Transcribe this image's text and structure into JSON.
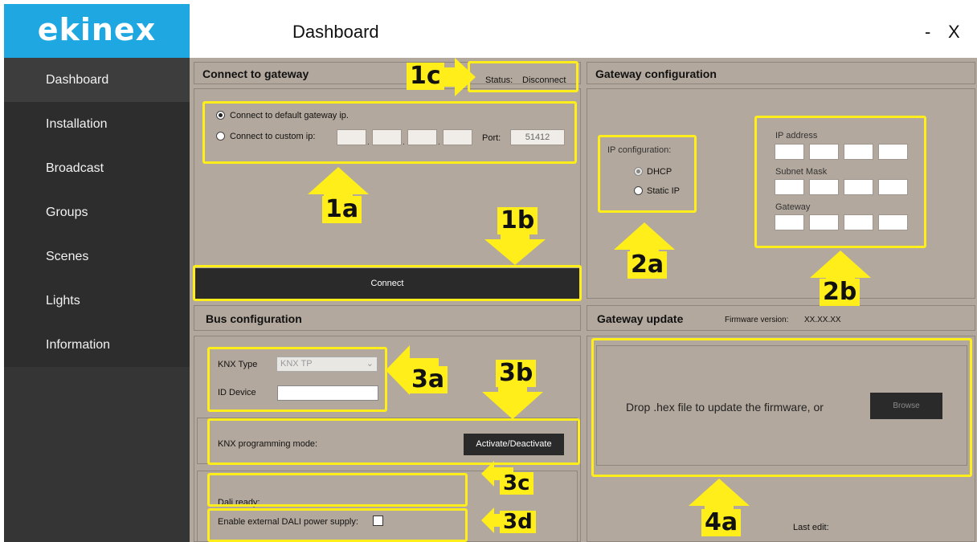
{
  "app": {
    "logo_text": "ekinex",
    "title": "Dashboard",
    "minimize_label": "-",
    "close_label": "X"
  },
  "sidebar": {
    "items": [
      {
        "label": "Dashboard",
        "active": true
      },
      {
        "label": "Installation",
        "active": false
      },
      {
        "label": "Broadcast",
        "active": false
      },
      {
        "label": "Groups",
        "active": false
      },
      {
        "label": "Scenes",
        "active": false
      },
      {
        "label": "Lights",
        "active": false
      },
      {
        "label": "Information",
        "active": false
      }
    ]
  },
  "connect": {
    "title": "Connect to gateway",
    "status_label": "Status:",
    "status_value": "Disconnect",
    "option_default": "Connect to default gateway ip.",
    "option_custom": "Connect to custom ip:",
    "port_label": "Port:",
    "port_value": "51412",
    "connect_button": "Connect"
  },
  "gateway_config": {
    "title": "Gateway configuration",
    "ip_config_label": "IP configuration:",
    "dhcp_label": "DHCP",
    "static_label": "Static IP",
    "ip_address_label": "IP address",
    "subnet_label": "Subnet Mask",
    "gateway_label": "Gateway"
  },
  "bus": {
    "title": "Bus configuration",
    "knx_type_label": "KNX Type",
    "knx_type_value": "KNX TP",
    "id_device_label": "ID Device",
    "id_device_value": "",
    "prog_mode_label": "KNX programming mode:",
    "activate_button": "Activate/Deactivate",
    "dali_ready_label": "Dali ready:",
    "dali_power_label": "Enable external DALI power supply:"
  },
  "update": {
    "title": "Gateway update",
    "firmware_label": "Firmware version:",
    "firmware_value": "XX.XX.XX",
    "drop_text": "Drop .hex file to update the firmware, or",
    "browse_button": "Browse",
    "last_edit_label": "Last edit:"
  },
  "callouts": [
    "1a",
    "1b",
    "1c",
    "2a",
    "2b",
    "3a",
    "3b",
    "3c",
    "3d",
    "4a"
  ],
  "colors": {
    "brand_blue": "#1ea7e1",
    "sidebar_bg": "#2d2d2d",
    "content_bg": "#b3a89d",
    "highlight_yellow": "#ffee1a"
  }
}
